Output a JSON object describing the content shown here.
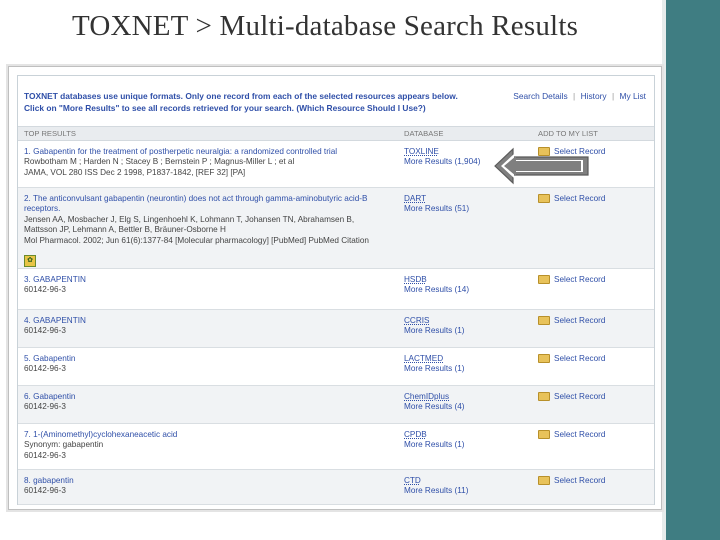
{
  "slide": {
    "title": "TOXNET > Multi-database Search Results"
  },
  "notice": {
    "line1": "TOXNET databases use unique formats. Only one record from each of the selected resources appears below.",
    "line2": "Click on \"More Results\" to see all records retrieved for your search. (Which Resource Should I Use?)"
  },
  "toplinks": {
    "search_details": "Search Details",
    "history": "History",
    "my_list": "My List",
    "sep": "|"
  },
  "table": {
    "headers": {
      "results": "TOP RESULTS",
      "database": "DATABASE",
      "add": "ADD TO MY LIST"
    },
    "add_label": "Select Record",
    "rows": [
      {
        "title": "1. Gabapentin for the treatment of postherpetic neuralgia: a randomized controlled trial",
        "details": [
          "Rowbotham M ; Harden N ; Stacey B ; Bernstein P ; Magnus-Miller L ; et al",
          "JAMA, VOL 280 ISS Dec 2 1998, P1837-1842, [REF 32] [PA]"
        ],
        "db": "TOXLINE",
        "more": "More Results (1,904)"
      },
      {
        "title": "2. The anticonvulsant gabapentin (neurontin) does not act through gamma-aminobutyric acid-B receptors.",
        "details": [
          "Jensen AA, Mosbacher J, Elg S, Lingenhoehl K, Lohmann T, Johansen TN, Abrahamsen B,",
          "Mattsson JP, Lehmann A, Bettler B, Bräuner-Osborne H",
          "Mol Pharmacol. 2002; Jun 61(6):1377-84 [Molecular pharmacology] [PubMed] PubMed Citation"
        ],
        "db": "DART",
        "more": "More Results (51)"
      },
      {
        "title": "3. GABAPENTIN",
        "details": [
          "60142-96-3"
        ],
        "db": "HSDB",
        "more": "More Results (14)"
      },
      {
        "title": "4. GABAPENTIN",
        "details": [
          "60142-96-3"
        ],
        "db": "CCRIS",
        "more": "More Results (1)"
      },
      {
        "title": "5. Gabapentin",
        "details": [
          "60142-96-3"
        ],
        "db": "LACTMED",
        "more": "More Results (1)"
      },
      {
        "title": "6. Gabapentin",
        "details": [
          "60142-96-3"
        ],
        "db": "ChemIDplus",
        "more": "More Results (4)"
      },
      {
        "title": "7. 1-(Aminomethyl)cyclohexaneacetic acid",
        "details": [
          "Synonym: gabapentin",
          "60142-96-3"
        ],
        "db": "CPDB",
        "more": "More Results (1)"
      },
      {
        "title": "8. gabapentin",
        "details": [
          "60142-96-3"
        ],
        "db": "CTD",
        "more": "More Results (11)"
      }
    ]
  },
  "colors": {
    "accent_band": "#3f7d82",
    "link": "#2f4fa8",
    "arrow_fill": "#7f7f7f"
  },
  "icons": {
    "arrow": "left-arrow-icon",
    "folder": "folder-icon",
    "pubchem": "pubchem-logo-icon"
  }
}
